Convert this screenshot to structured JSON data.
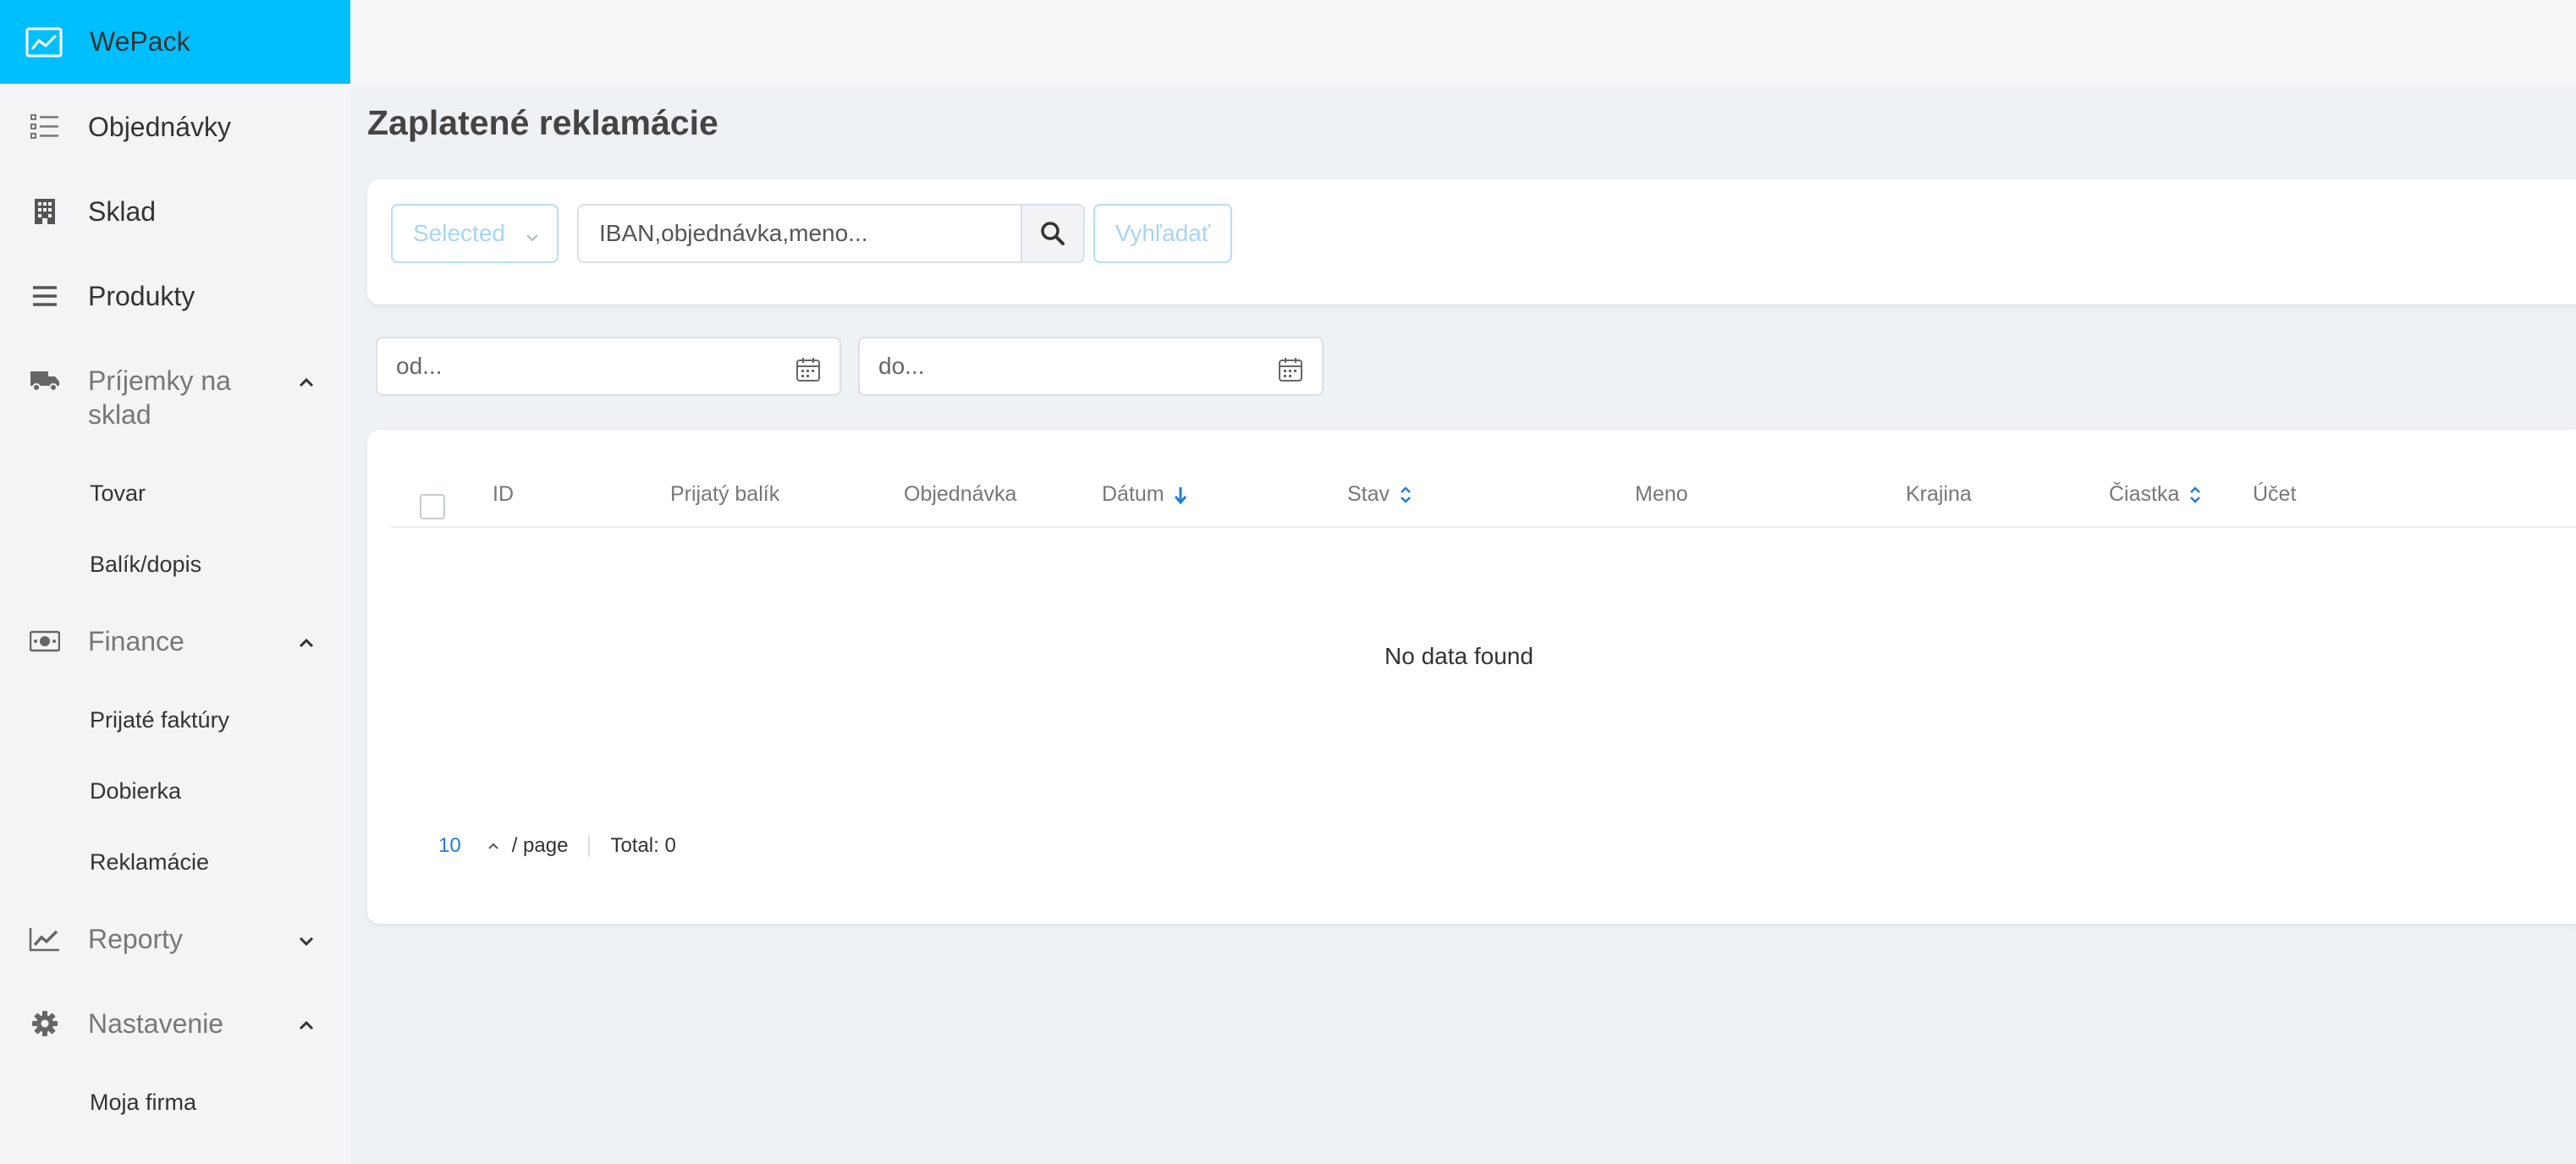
{
  "app": {
    "name": "WePack"
  },
  "sidebar": {
    "items": [
      {
        "label": "Objednávky",
        "icon": "list-icon"
      },
      {
        "label": "Sklad",
        "icon": "building-icon"
      },
      {
        "label": "Produkty",
        "icon": "menu-lines-icon"
      },
      {
        "label": "Príjemky na sklad",
        "icon": "truck-icon",
        "expanded": true,
        "children": [
          "Tovar",
          "Balík/dopis"
        ]
      },
      {
        "label": "Finance",
        "icon": "money-icon",
        "expanded": true,
        "children": [
          "Prijaté faktúry",
          "Dobierka",
          "Reklamácie"
        ]
      },
      {
        "label": "Reporty",
        "icon": "chart-line-icon",
        "expanded": false
      },
      {
        "label": "Nastavenie",
        "icon": "gear-icon",
        "expanded": true,
        "children": [
          "Moja firma"
        ]
      }
    ]
  },
  "page": {
    "title": "Zaplatené reklamácie"
  },
  "filters": {
    "select_value": "Selected",
    "search_placeholder": "IBAN,objednávka,meno...",
    "search_button": "Vyhľadať",
    "date_from_placeholder": "od...",
    "date_to_placeholder": "do..."
  },
  "table": {
    "columns": [
      "ID",
      "Prijatý balík",
      "Objednávka",
      "Dátum",
      "Stav",
      "Meno",
      "Krajina",
      "Čiastka",
      "Účet"
    ],
    "empty_text": "No data found",
    "pagination": {
      "page_size": "10",
      "per_page_label": "/ page",
      "total_label": "Total: 0"
    }
  },
  "colors": {
    "brand": "#00bfff",
    "accent": "#1e7fd8"
  }
}
